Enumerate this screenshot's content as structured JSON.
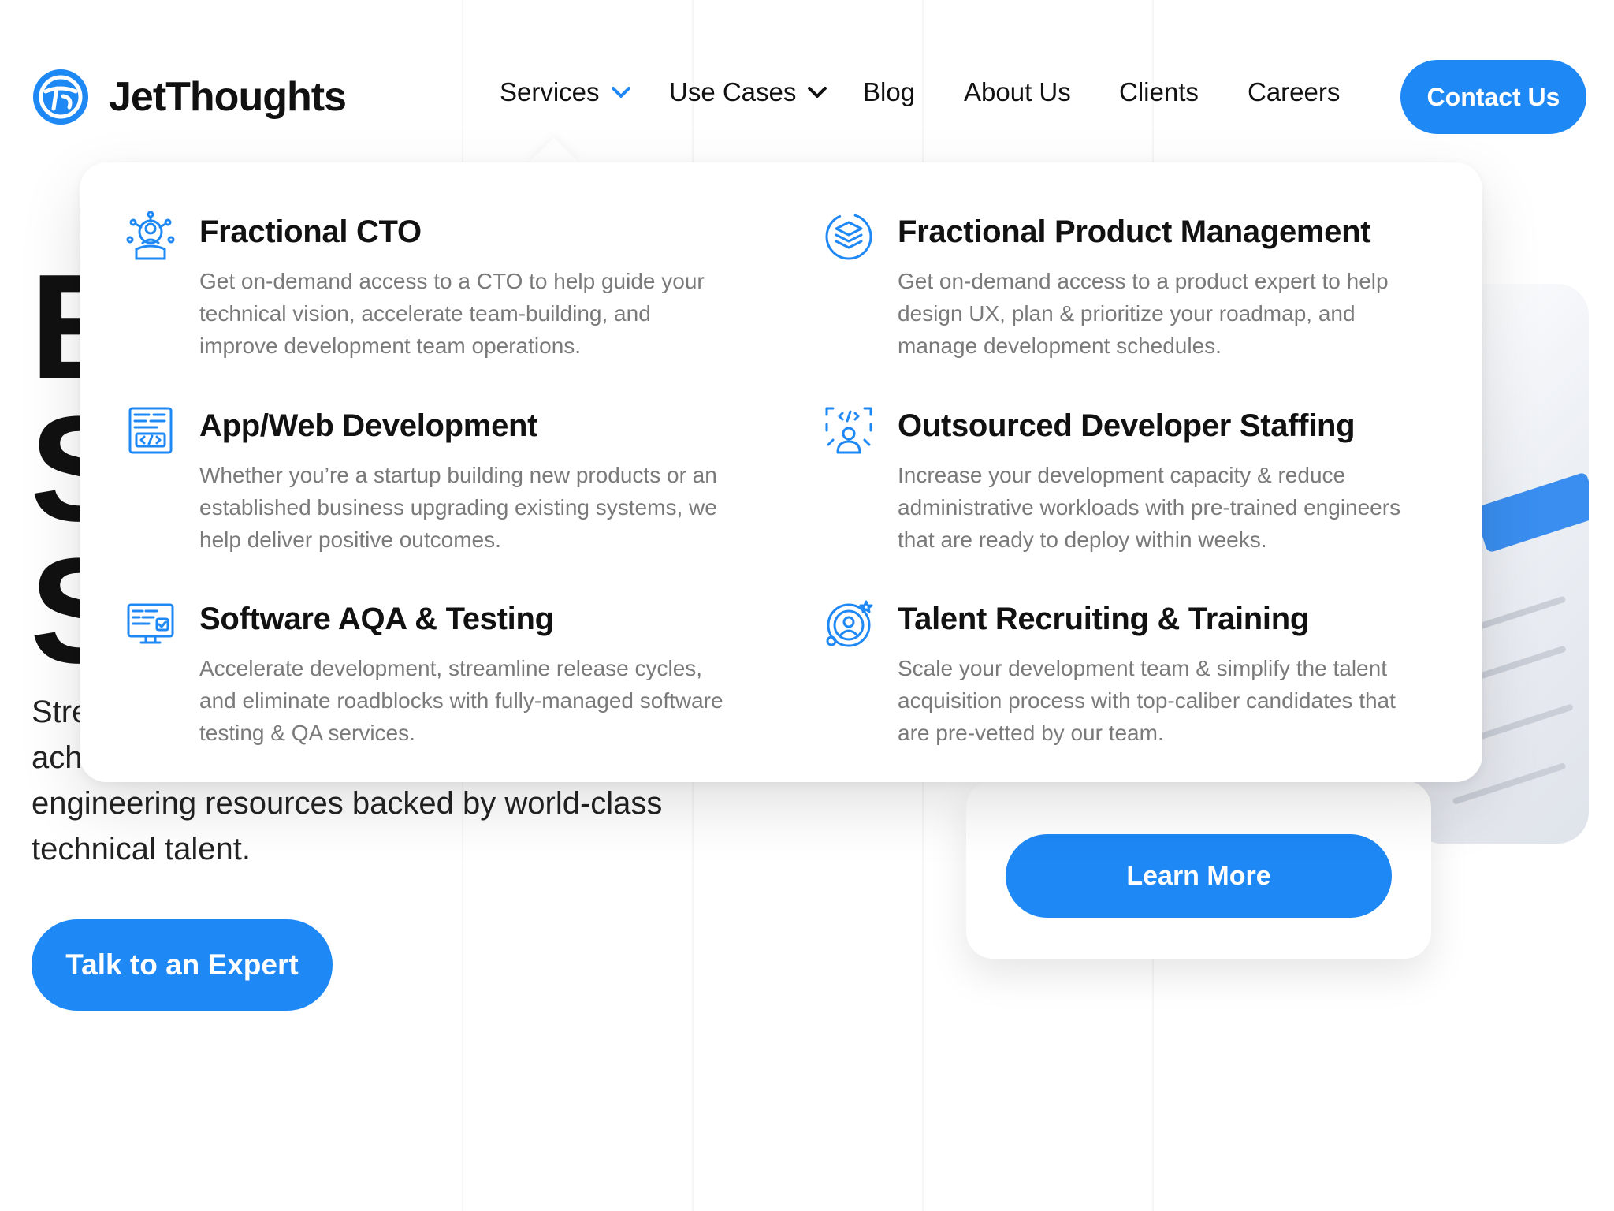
{
  "brand": {
    "name": "JetThoughts",
    "accent": "#1e88f5"
  },
  "nav": {
    "items": [
      {
        "label": "Services",
        "has_dropdown": true,
        "active": true
      },
      {
        "label": "Use Cases",
        "has_dropdown": true,
        "active": false
      },
      {
        "label": "Blog"
      },
      {
        "label": "About Us"
      },
      {
        "label": "Clients"
      },
      {
        "label": "Careers"
      }
    ],
    "contact_label": "Contact Us"
  },
  "hero": {
    "big_letters": [
      "E",
      "S",
      "S"
    ],
    "para_lines": [
      "Stre",
      "ach",
      "engineering resources backed by world-class",
      "technical talent."
    ],
    "cta_label": "Talk to an Expert",
    "learn_more_label": "Learn More"
  },
  "services": [
    {
      "icon": "cto-icon",
      "title": "Fractional CTO",
      "desc_lines": [
        "Get on-demand access to a CTO to help guide your",
        "technical vision, accelerate team-building, and",
        "improve development team operations."
      ]
    },
    {
      "icon": "product-management-icon",
      "title": "Fractional Product Management",
      "desc_lines": [
        "Get on-demand access to a product expert to help",
        "design UX, plan & prioritize your roadmap, and",
        "manage development schedules."
      ]
    },
    {
      "icon": "web-development-icon",
      "title": "App/Web Development",
      "desc_lines": [
        "Whether you’re a startup building new products or an",
        "established business upgrading existing systems, we",
        "help deliver positive outcomes."
      ]
    },
    {
      "icon": "developer-staffing-icon",
      "title": "Outsourced Developer Staffing",
      "desc_lines": [
        "Increase your development capacity & reduce",
        "administrative workloads with pre-trained engineers",
        "that are ready to deploy within weeks."
      ]
    },
    {
      "icon": "testing-icon",
      "title": "Software AQA & Testing",
      "desc_lines": [
        "Accelerate development, streamline release cycles,",
        "and eliminate roadblocks with fully-managed software",
        "testing & QA services."
      ]
    },
    {
      "icon": "talent-recruiting-icon",
      "title": "Talent Recruiting & Training",
      "desc_lines": [
        "Scale your development team & simplify the talent",
        "acquisition process with top-caliber candidates that",
        "are pre-vetted by our team."
      ]
    }
  ]
}
